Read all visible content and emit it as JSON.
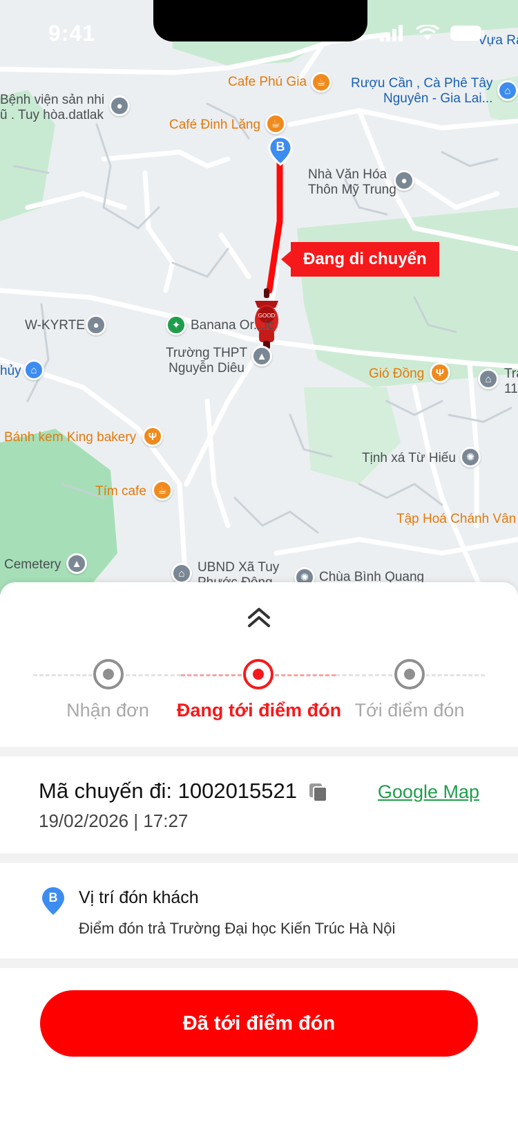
{
  "status_bar": {
    "time": "9:41"
  },
  "map": {
    "route_label": "Đang di chuyển",
    "route_end_marker": "B",
    "pois": [
      {
        "name": "vura-ra",
        "text": "Vựa Ra",
        "color": "#1a5fb4"
      },
      {
        "name": "benh-vien",
        "text": "Bệnh viện sản nhi\nũ . Tuy hòa.datlak"
      },
      {
        "name": "cafe-phu-gia",
        "text": "Cafe Phú Gia"
      },
      {
        "name": "cafe-dinh-lang",
        "text": "Café Đinh Lăng"
      },
      {
        "name": "ruou-can",
        "text": "Rượu Cần , Cà Phê Tây\nNguyên - Gia Lai..."
      },
      {
        "name": "nha-van-hoa",
        "text": "Nhà Văn Hóa\nThôn Mỹ Trung"
      },
      {
        "name": "w-kyrte",
        "text": "W-KYRTE"
      },
      {
        "name": "banana",
        "text": "Banana Or...ic"
      },
      {
        "name": "truong-thpt",
        "text": "Trường THPT\nNguyễn Diêu"
      },
      {
        "name": "huy",
        "text": "hủy"
      },
      {
        "name": "gio-dong",
        "text": "Gió Đồng"
      },
      {
        "name": "tra",
        "text": "Tra\n11"
      },
      {
        "name": "banh-kem",
        "text": "Bánh kem King bakery"
      },
      {
        "name": "tinh-xa",
        "text": "Tịnh xá Từ Hiếu"
      },
      {
        "name": "tim-cafe",
        "text": "Tím cafe"
      },
      {
        "name": "tap-hoa",
        "text": "Tập Hoá Chánh Vân"
      },
      {
        "name": "cemetery",
        "text": "Cemetery"
      },
      {
        "name": "ubnd",
        "text": "UBND Xã Tuy\nPhước Đông"
      },
      {
        "name": "chua",
        "text": "Chùa Bình Quang"
      }
    ],
    "icons": {
      "cafe": "cup-icon",
      "restaurant": "fork-knife-icon",
      "pin": "location-pin-icon",
      "school": "graduation-cap-icon",
      "shop": "shopping-bag-icon",
      "temple": "temple-icon",
      "park": "hiker-icon"
    }
  },
  "sheet": {
    "steps": [
      {
        "label": "Nhận đơn",
        "state": "done"
      },
      {
        "label": "Đang tới điểm đón",
        "state": "active"
      },
      {
        "label": "Tới điểm đón",
        "state": "pending"
      }
    ],
    "trip": {
      "code_label": "Mã chuyến đi: 1002015521",
      "datetime": "19/02/2026 | 17:27",
      "map_link": "Google Map"
    },
    "pickup": {
      "marker": "B",
      "title": "Vị trí đón khách",
      "address": "Điểm đón trả Trường Đại học Kiến Trúc Hà Nội"
    },
    "cta_label": "Đã tới điểm đón"
  },
  "colors": {
    "brand_red": "#f5191b",
    "cta_red": "#ff0000",
    "link_green": "#1f9d4c",
    "inactive_gray": "#a8a8a8"
  }
}
